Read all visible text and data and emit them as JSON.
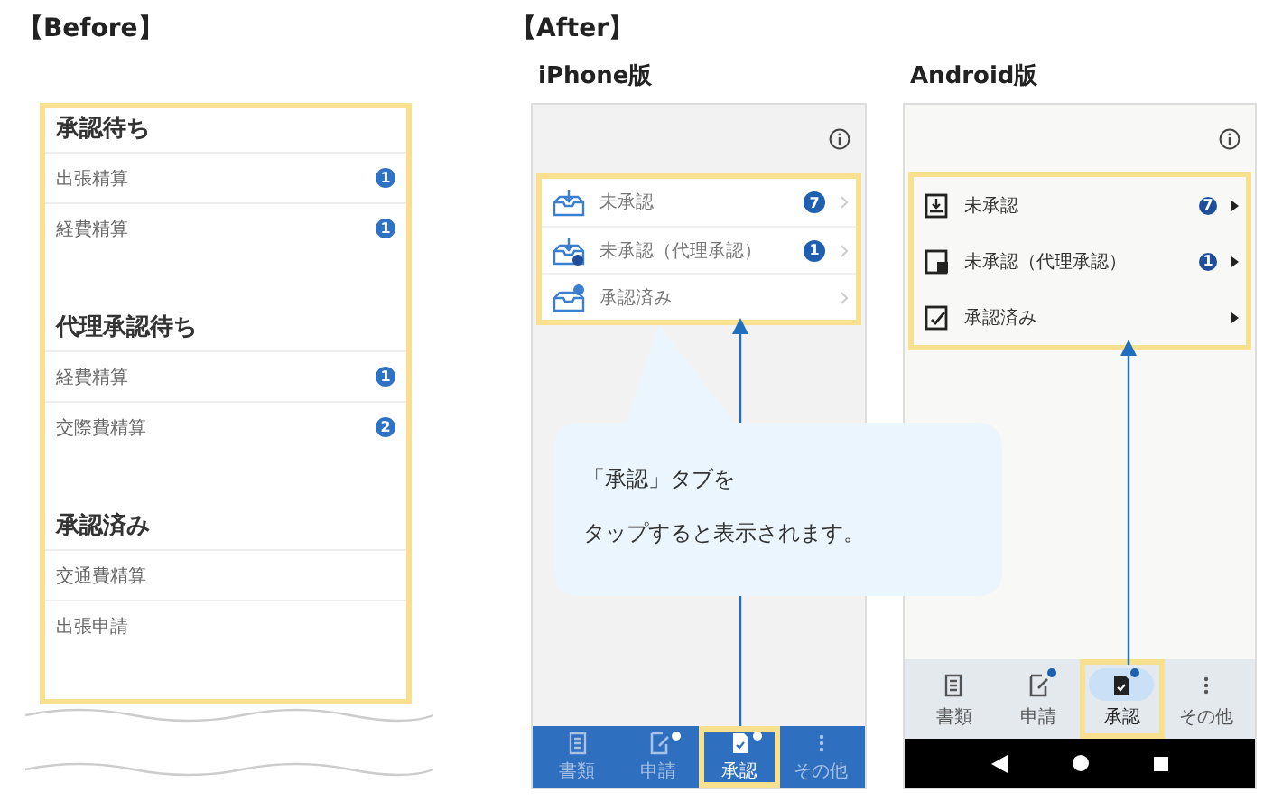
{
  "before": {
    "heading": "【Before】",
    "sections": [
      {
        "title": "承認待ち",
        "items": [
          {
            "label": "出張精算",
            "badge": "1"
          },
          {
            "label": "経費精算",
            "badge": "1"
          }
        ]
      },
      {
        "title": "代理承認待ち",
        "items": [
          {
            "label": "経費精算",
            "badge": "1"
          },
          {
            "label": "交際費精算",
            "badge": "2"
          }
        ]
      },
      {
        "title": "承認済み",
        "items": [
          {
            "label": "交通費精算"
          },
          {
            "label": "出張申請"
          }
        ]
      }
    ]
  },
  "after": {
    "heading": "【After】",
    "iphone": {
      "title": "iPhone版",
      "menu": [
        {
          "kind": "inbox",
          "label": "未承認",
          "badge": "7"
        },
        {
          "kind": "proxy",
          "label": "未承認（代理承認）",
          "badge": "1"
        },
        {
          "kind": "done",
          "label": "承認済み"
        }
      ],
      "tabs": [
        {
          "kind": "documents",
          "label": "書類",
          "selected": false,
          "notification": false
        },
        {
          "kind": "apply",
          "label": "申請",
          "selected": false,
          "notification": true
        },
        {
          "kind": "approve",
          "label": "承認",
          "selected": true,
          "notification": true
        },
        {
          "kind": "more",
          "label": "その他",
          "selected": false,
          "notification": false
        }
      ]
    },
    "android": {
      "title": "Android版",
      "menu": [
        {
          "kind": "inbox",
          "label": "未承認",
          "badge": "7"
        },
        {
          "kind": "proxy",
          "label": "未承認（代理承認）",
          "badge": "1"
        },
        {
          "kind": "done",
          "label": "承認済み"
        }
      ],
      "tabs": [
        {
          "kind": "documents",
          "label": "書類",
          "selected": false,
          "notification": false
        },
        {
          "kind": "apply",
          "label": "申請",
          "selected": false,
          "notification": true
        },
        {
          "kind": "approve",
          "label": "承認",
          "selected": true,
          "notification": true
        },
        {
          "kind": "more",
          "label": "その他",
          "selected": false,
          "notification": false
        }
      ]
    }
  },
  "callout": {
    "lines": [
      "「承認」タブを",
      "タップすると表示されます。"
    ]
  }
}
